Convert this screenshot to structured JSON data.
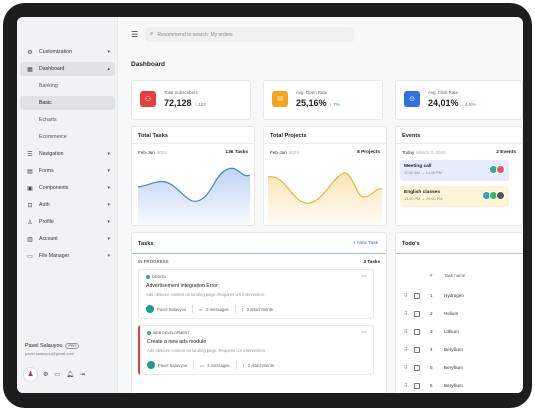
{
  "sidebar": {
    "items": [
      {
        "label": "Customization",
        "icon": "sliders-icon",
        "glyph": "⚙"
      },
      {
        "label": "Dashboard",
        "icon": "dashboard-icon",
        "glyph": "▦"
      },
      {
        "label": "Navigation",
        "icon": "navigation-icon",
        "glyph": "☰"
      },
      {
        "label": "Forms",
        "icon": "forms-icon",
        "glyph": "▤"
      },
      {
        "label": "Components",
        "icon": "components-icon",
        "glyph": "▣"
      },
      {
        "label": "Auth",
        "icon": "lock-icon",
        "glyph": "🔒"
      },
      {
        "label": "Profile",
        "icon": "user-icon",
        "glyph": "👤"
      },
      {
        "label": "Account",
        "icon": "account-icon",
        "glyph": "▥"
      },
      {
        "label": "File Manager",
        "icon": "folder-icon",
        "glyph": "📁"
      }
    ],
    "sub_items": [
      "Banking",
      "Basic",
      "Echarts",
      "Ecommerce"
    ],
    "user_name": "Pavel Salauyou",
    "user_badge": "PRO",
    "user_email": "pavel.salauyou@gmail.com"
  },
  "header": {
    "search_placeholder": "Recommend to search: My orders"
  },
  "page": {
    "title": "Dashboard"
  },
  "stats": [
    {
      "label": "Total Subscribers",
      "value": "72,128",
      "delta": "↑ 122",
      "delta_color": "#2e9b5a",
      "color": "#e53e3e",
      "icon": "users-icon",
      "glyph": "👥"
    },
    {
      "label": "Avg. Open Rate",
      "value": "25,16%",
      "delta": "↑ 7%",
      "delta_color": "#2e9b5a",
      "color": "#f0a51a",
      "icon": "mail-icon",
      "glyph": "✉"
    },
    {
      "label": "Avg. Click Rate",
      "value": "24,01%",
      "delta": "↓ 4.5%",
      "delta_color": "#e53e3e",
      "color": "#2f6fe0",
      "icon": "click-icon",
      "glyph": "⊙"
    }
  ],
  "total_tasks": {
    "title": "Total Tasks",
    "range": "Feb-Jun",
    "year": "2024",
    "count": "136 Tasks",
    "color": "#4a7fe0"
  },
  "total_projects": {
    "title": "Total Projects",
    "range": "Feb-Jun",
    "year": "2024",
    "count": "8 Projects",
    "color": "#f0b429"
  },
  "events": {
    "title": "Events",
    "today": "Today",
    "date": "March 3, 2024",
    "count": "2 Events",
    "items": [
      {
        "name": "Meeting call",
        "time": "11:00 AM → 14:00 PM",
        "bg": "#e6ecfb"
      },
      {
        "name": "English classes",
        "time": "13:00 PM → 20:00 PM",
        "bg": "#fdf3d6"
      }
    ]
  },
  "tasks": {
    "title": "Tasks",
    "new_label": "+  New Task",
    "column": "IN PROGRESS",
    "column_count": "3 Tasks",
    "items": [
      {
        "tag": "DESIGN",
        "tag_color": "#1aa3c9",
        "title": "Advertisement integration Error",
        "desc": "Ads obscure content on landing page. Requires UX intervention.",
        "assignee": "Pavel Salauyou",
        "messages": "3 messages",
        "attachments": "2 attachments",
        "border": "#e8e8ec"
      },
      {
        "tag": "WEB DEVELOPMENT",
        "tag_color": "#38b26a",
        "title": "Create a new ads module",
        "desc": "Ads obscure content on landing page. Requires UX intervention.",
        "assignee": "Pavel Salauyou",
        "messages": "3 messages",
        "attachments": "2 attachments",
        "border": "#e53e3e"
      }
    ]
  },
  "todos": {
    "title": "Todo's",
    "header_num": "#",
    "header_name": "Task name",
    "rows": [
      {
        "num": "1",
        "name": "Hydrogen"
      },
      {
        "num": "2",
        "name": "Helium"
      },
      {
        "num": "3",
        "name": "Lithium"
      },
      {
        "num": "4",
        "name": "Beryllium"
      },
      {
        "num": "5",
        "name": "Beryllium"
      },
      {
        "num": "6",
        "name": "Beryllium"
      }
    ]
  }
}
